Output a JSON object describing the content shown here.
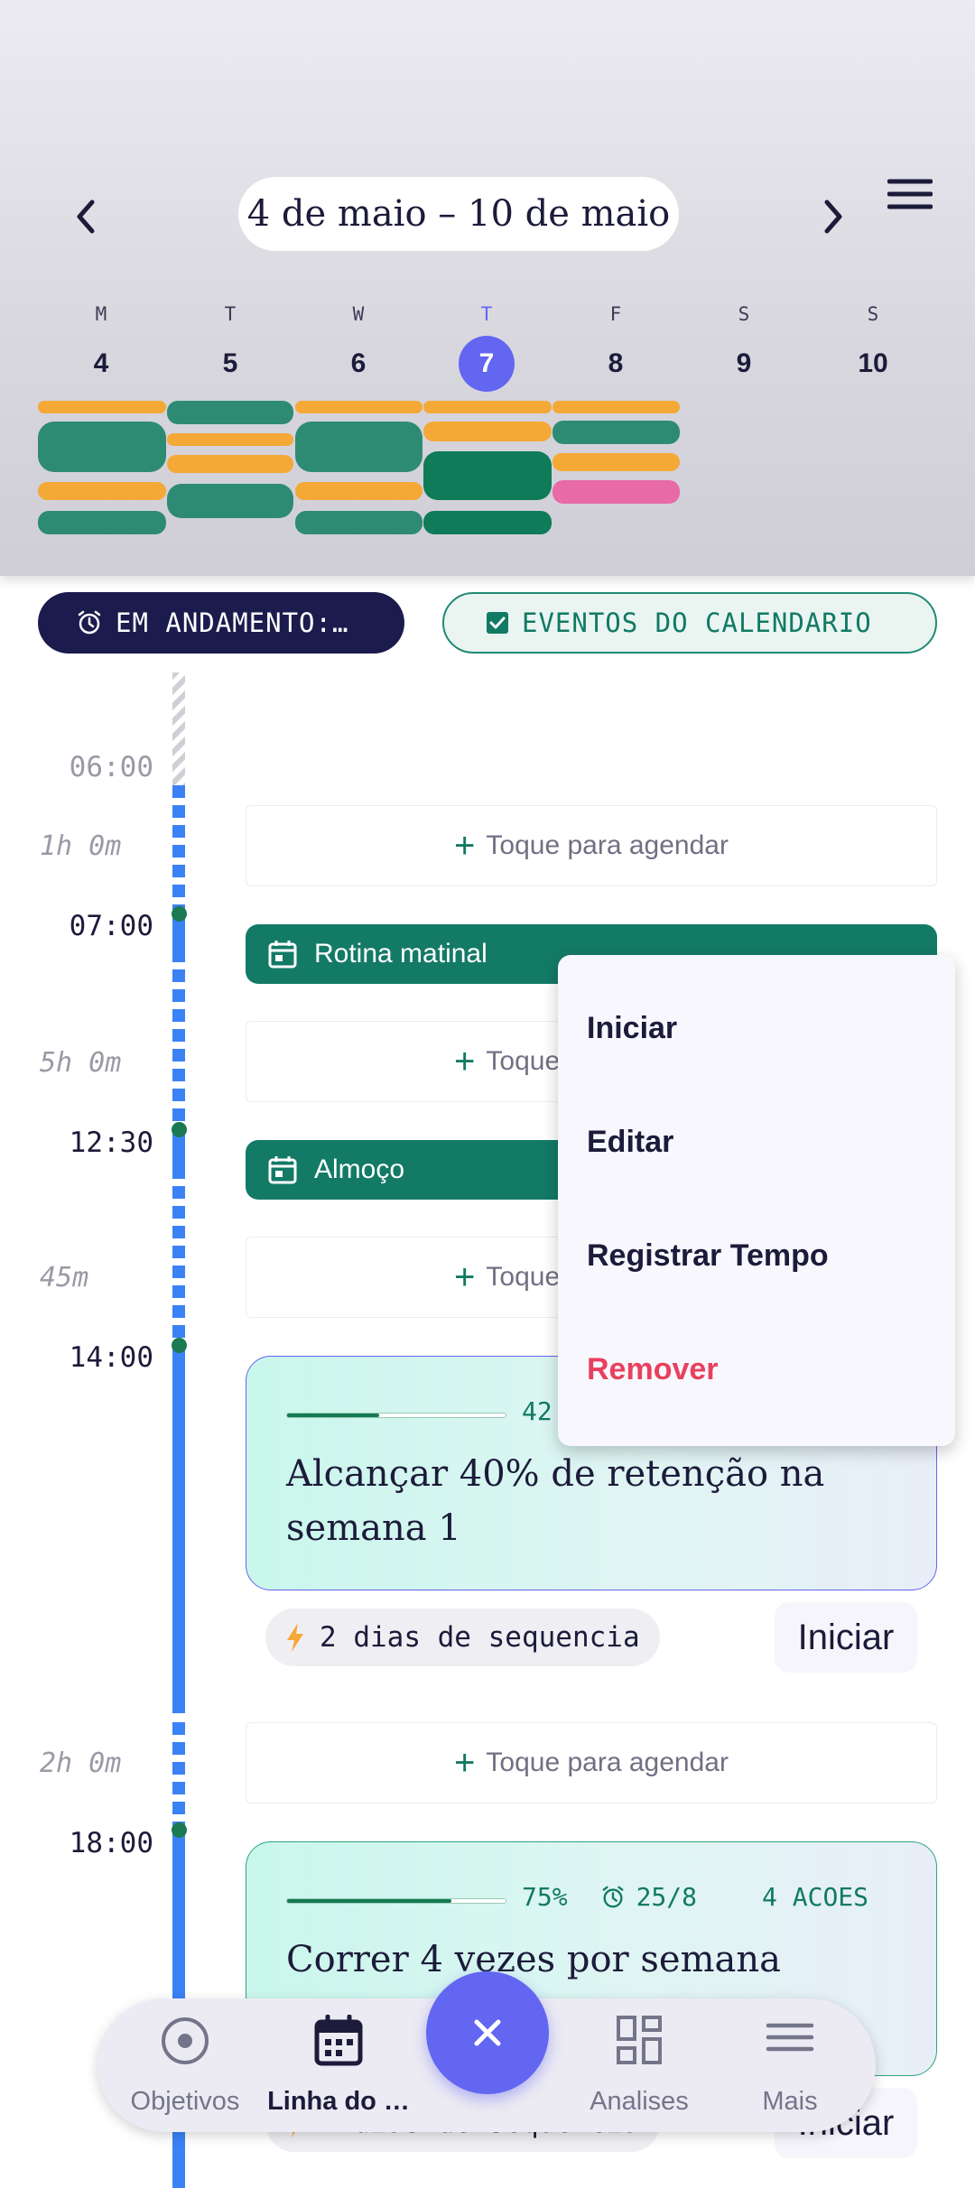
{
  "header": {
    "date_range": "4 de maio – 10 de maio",
    "days": [
      {
        "letter": "M",
        "number": "4"
      },
      {
        "letter": "T",
        "number": "5"
      },
      {
        "letter": "W",
        "number": "6"
      },
      {
        "letter": "T",
        "number": "7",
        "today": true
      },
      {
        "letter": "F",
        "number": "8"
      },
      {
        "letter": "S",
        "number": "9"
      },
      {
        "letter": "S",
        "number": "10"
      }
    ]
  },
  "filters": {
    "running_label": "EM ANDAMENTO:…",
    "calendar_label": "EVENTOS DO CALENDARIO"
  },
  "timeline": {
    "times": {
      "t0600": "06:00",
      "t0700": "07:00",
      "t1230": "12:30",
      "t1400": "14:00",
      "t1800": "18:00"
    },
    "durations": {
      "d1": "1h 0m",
      "d2": "5h 0m",
      "d3": "45m",
      "d4": "2h 0m"
    },
    "schedule_label": "Toque para agendar",
    "events": {
      "morning": "Rotina matinal",
      "lunch": "Almoço"
    }
  },
  "goals": [
    {
      "progress": 0.42,
      "percent_label": "42",
      "title": "Alcançar 40% de retenção na semana 1",
      "streak": "2 dias de sequencia",
      "start_label": "Iniciar"
    },
    {
      "progress": 0.75,
      "percent_label": "75%",
      "deadline": "25/8",
      "actions": "4 ACOES",
      "title": "Correr 4 vezes por semana",
      "streak": "2 dias de sequencia",
      "start_label": "Iniciar"
    }
  ],
  "context_menu": {
    "start": "Iniciar",
    "edit": "Editar",
    "log_time": "Registrar Tempo",
    "remove": "Remover"
  },
  "bottom_nav": {
    "goals": "Objetivos",
    "timeline": "Linha do …",
    "analytics": "Analises",
    "more": "Mais"
  },
  "colors": {
    "accent": "#6366f1",
    "primary_green": "#137a66",
    "danger": "#e8405e",
    "timeline_blue": "#3b82f6"
  }
}
